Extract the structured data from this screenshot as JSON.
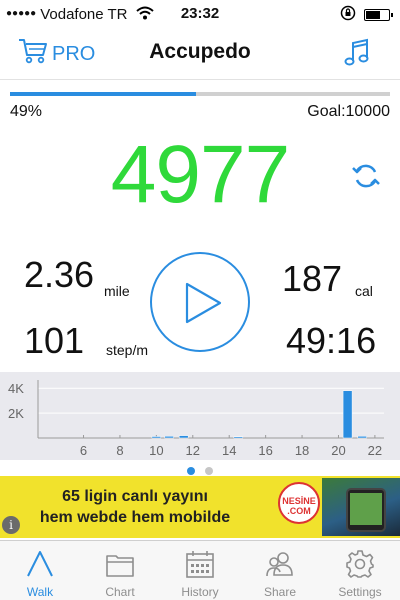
{
  "status_bar": {
    "signal": "●●●●●",
    "carrier": "Vodafone TR",
    "time": "23:32"
  },
  "nav": {
    "pro_label": "PRO",
    "title": "Accupedo"
  },
  "progress": {
    "percent_label": "49%",
    "fraction": 0.49,
    "goal_label": "Goal:10000"
  },
  "steps": "4977",
  "stats": {
    "distance_value": "2.36",
    "distance_unit": "mile",
    "calories_value": "187",
    "calories_unit": "cal",
    "pace_value": "101",
    "pace_unit": "step/m",
    "time_value": "49:16"
  },
  "chart_data": {
    "type": "bar",
    "y_ticks": [
      "4K",
      "2K"
    ],
    "x_ticks": [
      "6",
      "8",
      "10",
      "12",
      "14",
      "16",
      "18",
      "20",
      "22"
    ],
    "xlim": [
      3.5,
      22.5
    ],
    "ylim": [
      0,
      4500
    ],
    "hours": [
      10,
      10.7,
      11.5,
      14.5,
      20.5,
      21.3
    ],
    "values": [
      120,
      140,
      190,
      100,
      3800,
      140
    ]
  },
  "pager": {
    "pages": 2,
    "active": 0
  },
  "ad": {
    "line1": "65 ligin canlı yayını",
    "line2": "hem webde hem mobilde",
    "brand": "NESİNE .COM",
    "info": "i"
  },
  "colors": {
    "accent": "#2a8de0",
    "steps": "#2fd93a",
    "ad_background": "#f1e22c"
  },
  "tabs": [
    {
      "label": "Walk",
      "icon": "walk-icon",
      "active": true
    },
    {
      "label": "Chart",
      "icon": "folder-icon",
      "active": false
    },
    {
      "label": "History",
      "icon": "calendar-icon",
      "active": false
    },
    {
      "label": "Share",
      "icon": "people-icon",
      "active": false
    },
    {
      "label": "Settings",
      "icon": "gear-icon",
      "active": false
    }
  ]
}
